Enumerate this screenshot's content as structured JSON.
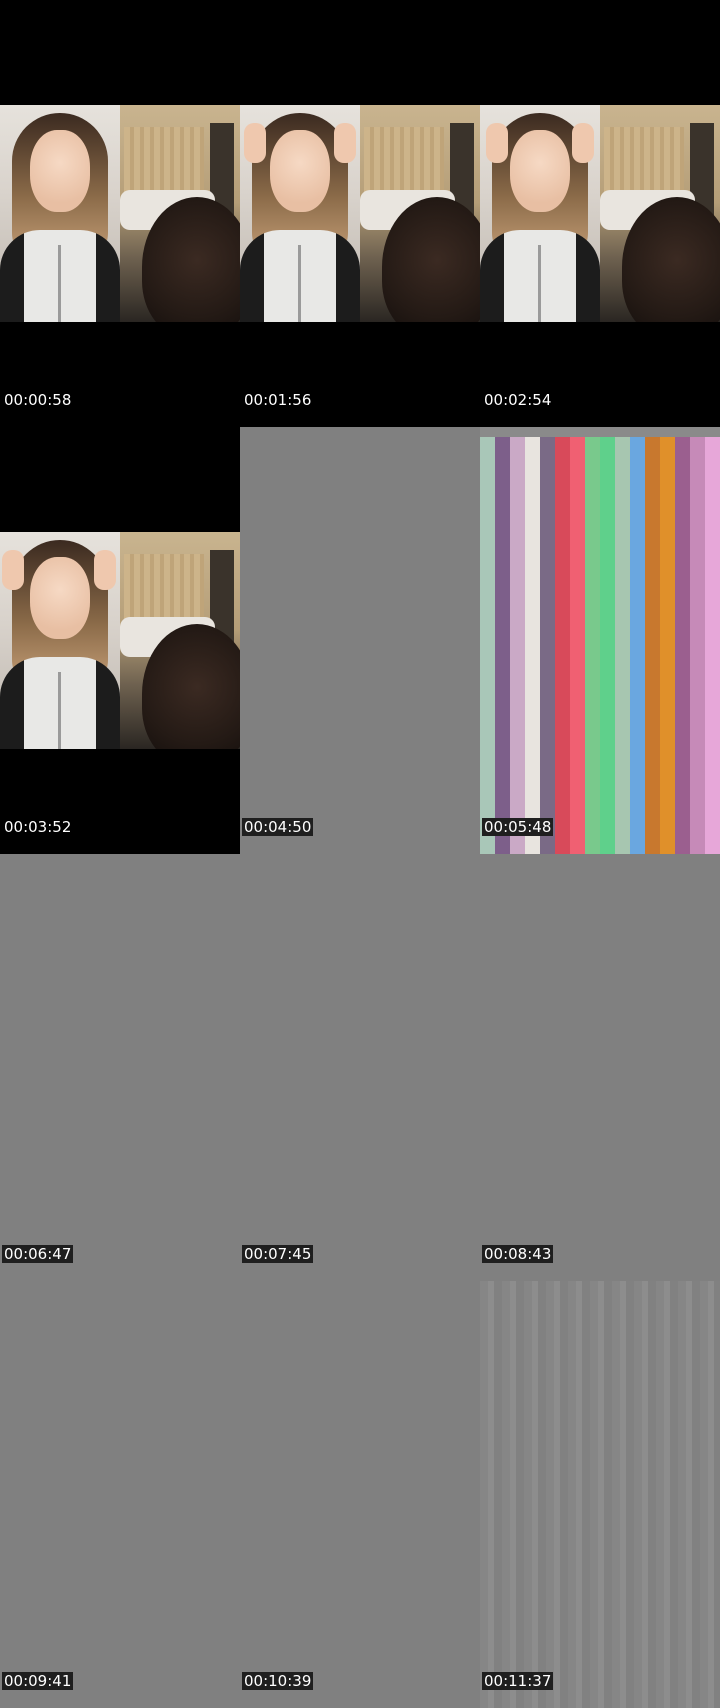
{
  "tiles": [
    {
      "timestamp": "00:00:58",
      "kind": "video",
      "gesture": "smile"
    },
    {
      "timestamp": "00:01:56",
      "kind": "video",
      "gesture": "hands-forehead"
    },
    {
      "timestamp": "00:02:54",
      "kind": "video",
      "gesture": "hands-forehead"
    },
    {
      "timestamp": "00:03:52",
      "kind": "video",
      "gesture": "hands-forehead"
    },
    {
      "timestamp": "00:04:50",
      "kind": "gray"
    },
    {
      "timestamp": "00:05:48",
      "kind": "color-bars"
    },
    {
      "timestamp": "00:06:47",
      "kind": "gray"
    },
    {
      "timestamp": "00:07:45",
      "kind": "gray"
    },
    {
      "timestamp": "00:08:43",
      "kind": "gray"
    },
    {
      "timestamp": "00:09:41",
      "kind": "gray"
    },
    {
      "timestamp": "00:10:39",
      "kind": "gray"
    },
    {
      "timestamp": "00:11:37",
      "kind": "gray-streaks"
    }
  ],
  "colors": {
    "black_bg": "#000000",
    "gray_bg": "#808080",
    "bars": [
      "#a9c7b8",
      "#7d5f8a",
      "#caa9c6",
      "#e8e4df",
      "#7a6a86",
      "#d84a5a",
      "#f06072",
      "#79c98c",
      "#5fd08b",
      "#a7c6b0",
      "#6aa7e0",
      "#c8782e",
      "#e0902a",
      "#9b5f8f",
      "#c68ab8",
      "#e7a7d9"
    ]
  }
}
